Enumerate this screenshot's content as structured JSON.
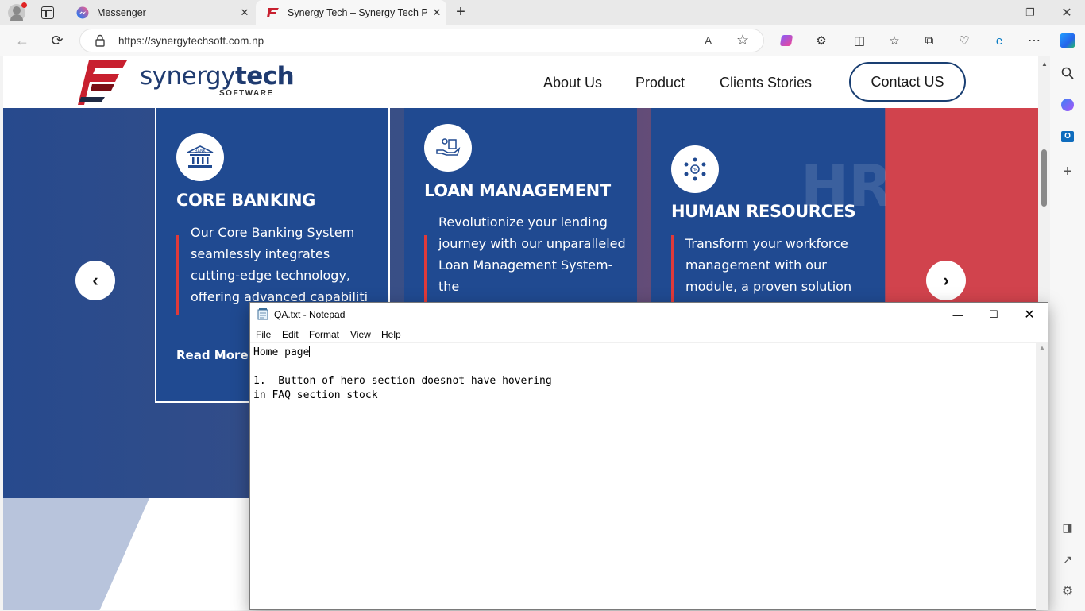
{
  "browser": {
    "tabs": [
      {
        "title": "Messenger",
        "active": false
      },
      {
        "title": "Synergy Tech – Synergy Tech Pvt.",
        "active": true
      }
    ],
    "url": "https://synergytechsoft.com.np"
  },
  "site": {
    "logo_text_1": "synergy",
    "logo_text_2": "tech",
    "logo_sub": "SOFTWARE",
    "nav": [
      "About Us",
      "Product",
      "Clients Stories"
    ],
    "contact_label": "Contact US",
    "cards": [
      {
        "icon": "bank-icon",
        "title": "CORE BANKING",
        "desc": "Our Core Banking System seamlessly integrates cutting-edge technology, offering advanced capabiliti",
        "readmore": "Read More"
      },
      {
        "icon": "loan-hand-icon",
        "title": "LOAN MANAGEMENT",
        "desc": "Revolutionize your lending journey with our unparalleled Loan Management System-the"
      },
      {
        "icon": "hr-network-icon",
        "title": "HUMAN RESOURCES",
        "desc": "Transform your workforce management with our module, a proven solution"
      }
    ],
    "colors": {
      "brand_navy": "#1f3b70",
      "brand_red": "#c8202f",
      "card_blue": "#204a91",
      "hero_red": "#d1434d"
    }
  },
  "notepad": {
    "title": "QA.txt - Notepad",
    "menu": [
      "File",
      "Edit",
      "Format",
      "View",
      "Help"
    ],
    "lines": [
      "Home page",
      "",
      "1.  Button of hero section doesnot have hovering",
      "in FAQ section stock"
    ]
  }
}
